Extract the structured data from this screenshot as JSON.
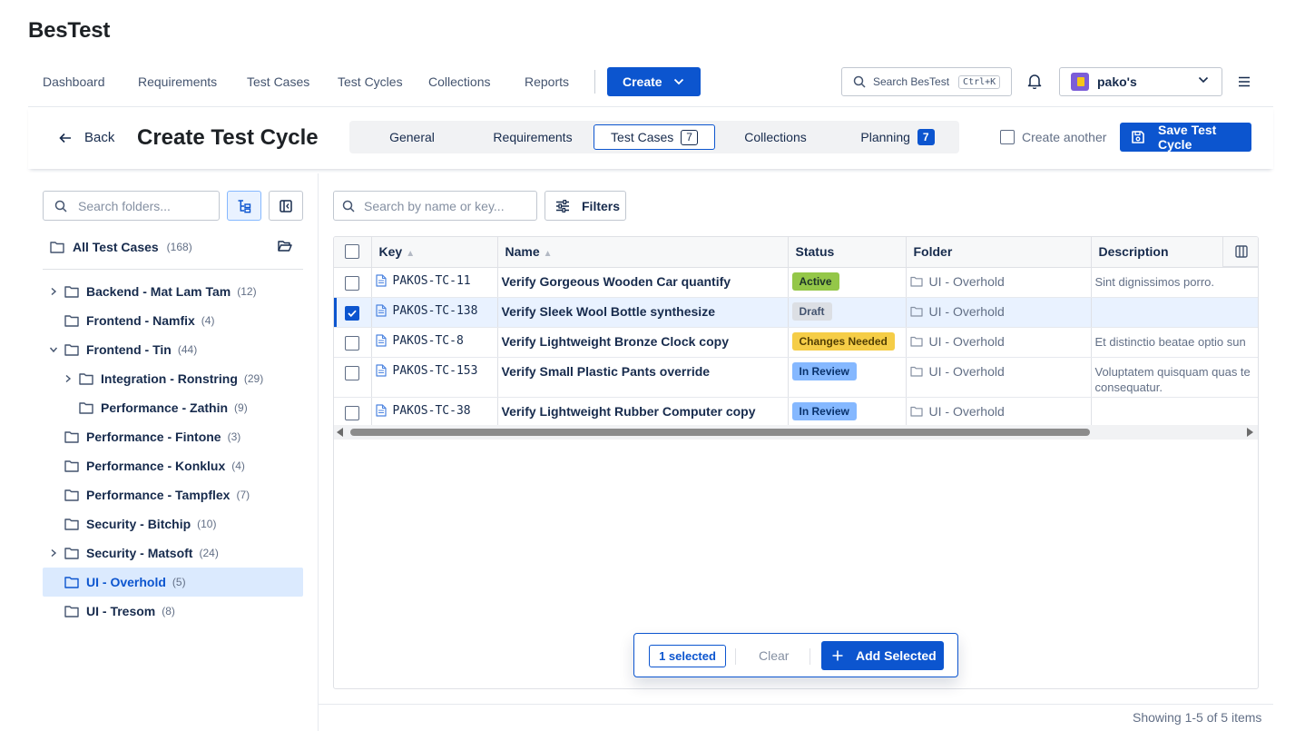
{
  "app": {
    "title": "BesTest"
  },
  "nav": {
    "items": [
      "Dashboard",
      "Requirements",
      "Test Cases",
      "Test Cycles",
      "Collections",
      "Reports"
    ],
    "create_label": "Create",
    "search_placeholder": "Search BesTest",
    "search_shortcut": "Ctrl+K",
    "workspace_name": "pako's"
  },
  "subheader": {
    "back_label": "Back",
    "title": "Create Test Cycle",
    "tabs": [
      {
        "label": "General"
      },
      {
        "label": "Requirements"
      },
      {
        "label": "Test Cases",
        "badge": "7"
      },
      {
        "label": "Collections"
      },
      {
        "label": "Planning",
        "badge": "7"
      }
    ],
    "active_tab": "Test Cases",
    "create_another_label": "Create another",
    "save_label": "Save Test Cycle"
  },
  "folders": {
    "search_placeholder": "Search folders...",
    "all_label": "All Test Cases",
    "all_count": "(168)",
    "items": [
      {
        "name": "Backend - Mat Lam Tam",
        "count": "(12)",
        "expandable": "collapsed",
        "level": 0
      },
      {
        "name": "Frontend - Namfix",
        "count": "(4)",
        "expandable": "none",
        "level": 0
      },
      {
        "name": "Frontend - Tin",
        "count": "(44)",
        "expandable": "expanded",
        "level": 0
      },
      {
        "name": "Integration - Ronstring",
        "count": "(29)",
        "expandable": "collapsed",
        "level": 1
      },
      {
        "name": "Performance - Zathin",
        "count": "(9)",
        "expandable": "none",
        "level": 1
      },
      {
        "name": "Performance - Fintone",
        "count": "(3)",
        "expandable": "none",
        "level": 0
      },
      {
        "name": "Performance - Konklux",
        "count": "(4)",
        "expandable": "none",
        "level": 0
      },
      {
        "name": "Performance - Tampflex",
        "count": "(7)",
        "expandable": "none",
        "level": 0
      },
      {
        "name": "Security - Bitchip",
        "count": "(10)",
        "expandable": "none",
        "level": 0
      },
      {
        "name": "Security - Matsoft",
        "count": "(24)",
        "expandable": "collapsed",
        "level": 0
      },
      {
        "name": "UI - Overhold",
        "count": "(5)",
        "expandable": "none",
        "level": 0,
        "selected": true
      },
      {
        "name": "UI - Tresom",
        "count": "(8)",
        "expandable": "none",
        "level": 0
      }
    ]
  },
  "cases": {
    "search_placeholder": "Search by name or key...",
    "filters_label": "Filters",
    "columns": [
      "Key",
      "Name",
      "Status",
      "Folder",
      "Description"
    ],
    "rows": [
      {
        "key": "PAKOS-TC-11",
        "name": "Verify Gorgeous Wooden Car quantify",
        "status": "Active",
        "status_class": "st-active",
        "folder": "UI - Overhold",
        "description": "Sint dignissimos porro.",
        "selected": false
      },
      {
        "key": "PAKOS-TC-138",
        "name": "Verify Sleek Wool Bottle synthesize",
        "status": "Draft",
        "status_class": "st-draft",
        "folder": "UI - Overhold",
        "description": "",
        "selected": true
      },
      {
        "key": "PAKOS-TC-8",
        "name": "Verify Lightweight Bronze Clock copy",
        "status": "Changes Needed",
        "status_class": "st-changes",
        "folder": "UI - Overhold",
        "description": "Et distinctio beatae optio sun",
        "selected": false
      },
      {
        "key": "PAKOS-TC-153",
        "name": "Verify Small Plastic Pants override",
        "status": "In Review",
        "status_class": "st-review",
        "folder": "UI - Overhold",
        "description": "Voluptatem quisquam quas te consequatur.",
        "selected": false
      },
      {
        "key": "PAKOS-TC-38",
        "name": "Verify Lightweight Rubber Computer copy",
        "status": "In Review",
        "status_class": "st-review",
        "folder": "UI - Overhold",
        "description": "",
        "selected": false
      }
    ]
  },
  "selection": {
    "count_label": "1 selected",
    "clear_label": "Clear",
    "add_label": "Add Selected"
  },
  "footer": {
    "pagination": "Showing 1-5 of 5 items"
  },
  "colors": {
    "primary": "#0c55cf",
    "selected_row": "#e9f2ff",
    "selected_folder": "#dbeafe"
  }
}
